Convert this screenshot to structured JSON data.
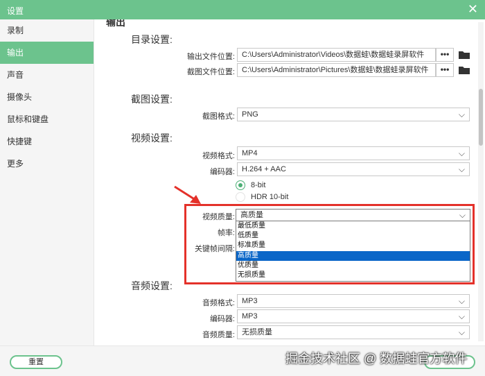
{
  "window": {
    "title": "设置",
    "close_glyph": "✕"
  },
  "sidebar": {
    "items": [
      {
        "label": "录制"
      },
      {
        "label": "输出"
      },
      {
        "label": "声音"
      },
      {
        "label": "摄像头"
      },
      {
        "label": "鼠标和键盘"
      },
      {
        "label": "快捷键"
      },
      {
        "label": "更多"
      }
    ],
    "active": "输出"
  },
  "main": {
    "header": "输出",
    "directory": {
      "title": "目录设置:",
      "output_label": "输出文件位置:",
      "output_path": "C:\\Users\\Administrator\\Videos\\数据蛙\\数据蛙录屏软件",
      "screenshot_label": "截图文件位置:",
      "screenshot_path": "C:\\Users\\Administrator\\Pictures\\数据蛙\\数据蛙录屏软件",
      "browse_glyph": "•••"
    },
    "screenshot": {
      "title": "截图设置:",
      "format_label": "截图格式:",
      "format_value": "PNG"
    },
    "video": {
      "title": "视频设置:",
      "format_label": "视频格式:",
      "format_value": "MP4",
      "encoder_label": "编码器:",
      "encoder_value": "H.264 + AAC",
      "bit_options": [
        "8-bit",
        "HDR 10-bit"
      ],
      "quality_label": "视频质量:",
      "quality_value": "高质量",
      "quality_options": [
        "最低质量",
        "低质量",
        "标准质量",
        "高质量",
        "优质量",
        "无损质量"
      ],
      "quality_selected_index": 3,
      "framerate_label": "帧率:",
      "keyframe_label": "关键帧间隔:"
    },
    "audio": {
      "title": "音频设置:",
      "format_label": "音频格式:",
      "format_value": "MP3",
      "encoder_label": "编码器:",
      "encoder_value": "MP3",
      "quality_label": "音频质量:",
      "quality_value": "无损质量"
    }
  },
  "footer": {
    "reset_label": "重置",
    "watermark": "掘金技术社区 @ 数据蛙官方软件"
  },
  "colors": {
    "accent": "#6cc38d",
    "highlight_border": "#e4312a",
    "selection": "#0a66c8"
  },
  "icons": {
    "close": "close-icon",
    "folder": "folder-icon",
    "chevron": "chevron-down-icon",
    "arrow": "red-arrow-icon"
  }
}
